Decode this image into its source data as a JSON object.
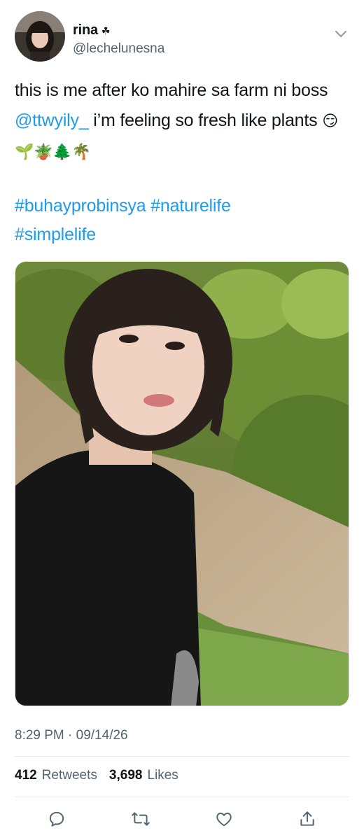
{
  "user": {
    "display_name": "rina",
    "name_badge": "☘",
    "handle": "@lechelunesna"
  },
  "tweet": {
    "text_1": "this is me after ko mahire sa farm ni boss ",
    "mention": "@ttwyily_",
    "text_2": " i’m feeling so fresh like plants ",
    "emojis": "😏🌱🪴🌲🌴",
    "hashtags": [
      "#buhayprobinsya",
      "#naturelife",
      "#simplelife"
    ]
  },
  "meta": {
    "timestamp": "8:29 PM · 09/14/26"
  },
  "stats": {
    "retweets_count": "412",
    "retweets_label": "Retweets",
    "likes_count": "3,698",
    "likes_label": "Likes"
  },
  "actions": [
    "reply-icon",
    "retweet-icon",
    "like-icon",
    "share-icon"
  ],
  "colors": {
    "link": "#1d9bf0",
    "secondary_text": "#536471",
    "divider": "#e7e9ea"
  }
}
